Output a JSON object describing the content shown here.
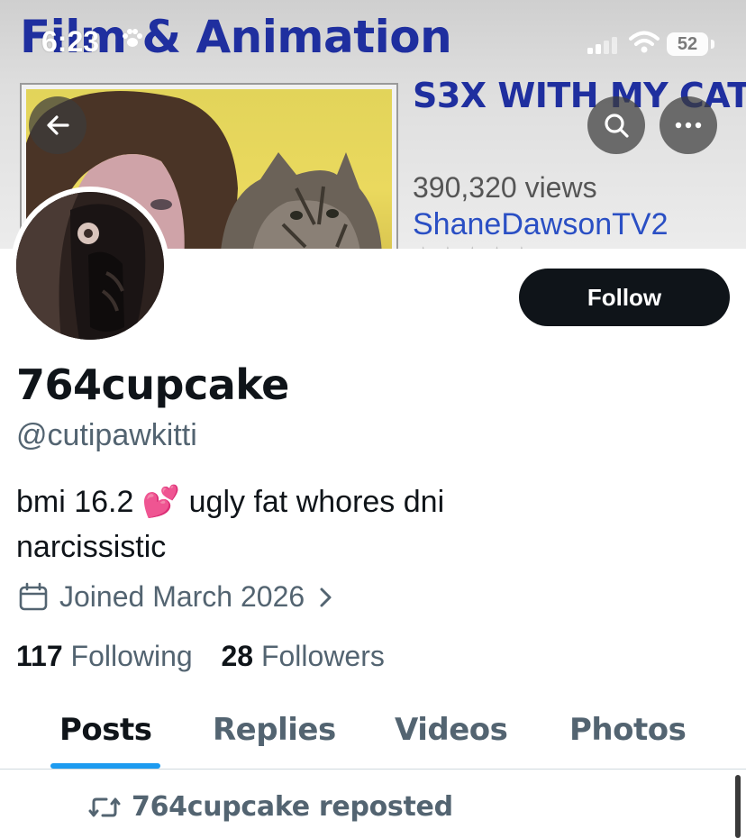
{
  "status_bar": {
    "time": "6:23",
    "battery": "52"
  },
  "banner": {
    "heading": "Film & Animation",
    "video_title": "S3X WITH MY CAT",
    "video_views": "390,320 views",
    "video_channel": "ShaneDawsonTV2",
    "rating_stars": "★★★★★"
  },
  "profile": {
    "display_name": "764cupcake",
    "handle": "@cutipawkitti",
    "bio_line_1": "bmi 16.2 💕 ugly fat whores dni",
    "bio_line_2": "narcissistic",
    "joined": "Joined March 2026",
    "following_count": "117",
    "following_label": "Following",
    "followers_count": "28",
    "followers_label": "Followers",
    "follow_button": "Follow"
  },
  "tabs": [
    {
      "label": "Posts",
      "active": true
    },
    {
      "label": "Replies",
      "active": false
    },
    {
      "label": "Videos",
      "active": false
    },
    {
      "label": "Photos",
      "active": false
    }
  ],
  "feed": {
    "repost_label": "764cupcake reposted"
  },
  "icons": {
    "back": "arrow-left-icon",
    "search": "search-icon",
    "more": "more-horizontal-icon",
    "calendar": "calendar-icon",
    "chevron": "chevron-right-icon",
    "repost": "repost-icon",
    "paw": "paw-icon",
    "signal": "signal-icon",
    "wifi": "wifi-icon"
  },
  "colors": {
    "accent": "#1d9bf0",
    "text_primary": "#0f1419",
    "text_secondary": "#536471",
    "banner_heading": "#1f2f9f",
    "banner_link": "#2a4fc4"
  }
}
